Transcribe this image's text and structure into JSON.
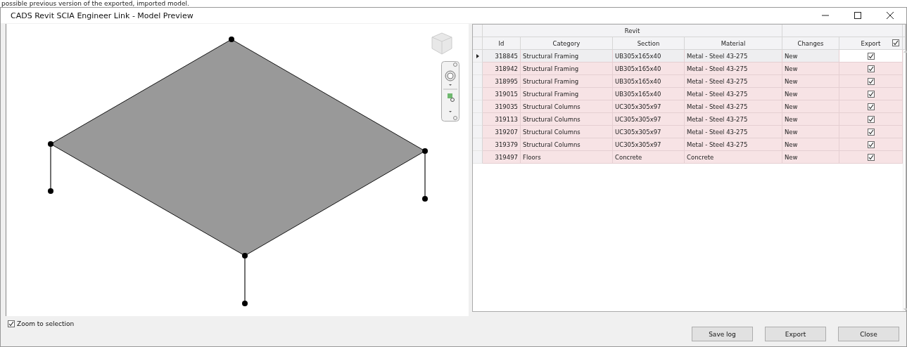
{
  "page_caption": "possible previous version of the exported, imported model.",
  "window": {
    "title": "CADS Revit SCIA Engineer Link - Model Preview"
  },
  "table": {
    "group_header": "Revit",
    "columns": [
      "Id",
      "Category",
      "Section",
      "Material",
      "Changes",
      "Export"
    ],
    "export_all_checked": true,
    "rows": [
      {
        "id": "318845",
        "category": "Structural Framing",
        "section": "UB305x165x40",
        "material": "Metal - Steel 43-275",
        "changes": "New",
        "export": true,
        "selected": true
      },
      {
        "id": "318942",
        "category": "Structural Framing",
        "section": "UB305x165x40",
        "material": "Metal - Steel 43-275",
        "changes": "New",
        "export": true,
        "selected": false
      },
      {
        "id": "318995",
        "category": "Structural Framing",
        "section": "UB305x165x40",
        "material": "Metal - Steel 43-275",
        "changes": "New",
        "export": true,
        "selected": false
      },
      {
        "id": "319015",
        "category": "Structural Framing",
        "section": "UB305x165x40",
        "material": "Metal - Steel 43-275",
        "changes": "New",
        "export": true,
        "selected": false
      },
      {
        "id": "319035",
        "category": "Structural Columns",
        "section": "UC305x305x97",
        "material": "Metal - Steel 43-275",
        "changes": "New",
        "export": true,
        "selected": false
      },
      {
        "id": "319113",
        "category": "Structural Columns",
        "section": "UC305x305x97",
        "material": "Metal - Steel 43-275",
        "changes": "New",
        "export": true,
        "selected": false
      },
      {
        "id": "319207",
        "category": "Structural Columns",
        "section": "UC305x305x97",
        "material": "Metal - Steel 43-275",
        "changes": "New",
        "export": true,
        "selected": false
      },
      {
        "id": "319379",
        "category": "Structural Columns",
        "section": "UC305x305x97",
        "material": "Metal - Steel 43-275",
        "changes": "New",
        "export": true,
        "selected": false
      },
      {
        "id": "319497",
        "category": "Floors",
        "section": "Concrete",
        "material": "Concrete",
        "changes": "New",
        "export": true,
        "selected": false
      }
    ]
  },
  "zoom_to_selection": {
    "label": "Zoom to selection",
    "checked": true
  },
  "buttons": [
    "Save log",
    "Export",
    "Close"
  ]
}
